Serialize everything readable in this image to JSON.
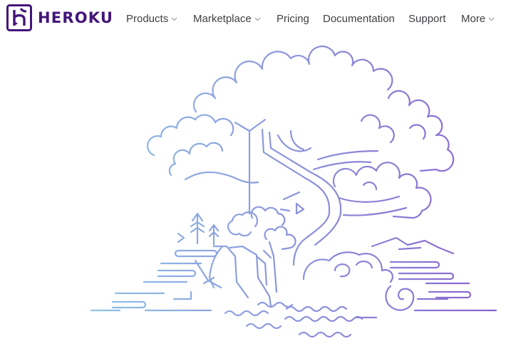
{
  "brand": {
    "name": "HEROKU",
    "color": "#43157a"
  },
  "nav": {
    "items": [
      {
        "label": "Products",
        "dropdown": true
      },
      {
        "label": "Marketplace",
        "dropdown": true
      },
      {
        "label": "Pricing",
        "dropdown": false
      },
      {
        "label": "Documentation",
        "dropdown": false
      },
      {
        "label": "Support",
        "dropdown": false
      },
      {
        "label": "More",
        "dropdown": true
      }
    ]
  },
  "hero": {
    "illustration": "tree-landscape-line-art",
    "gradient": [
      "#8fc3e6",
      "#8a63cf"
    ]
  }
}
